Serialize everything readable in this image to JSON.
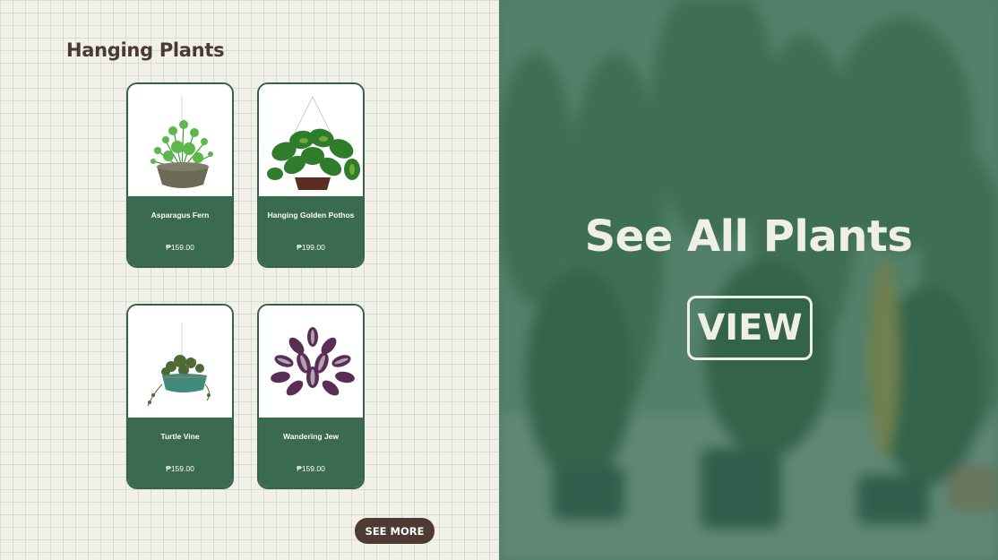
{
  "section": {
    "title": "Hanging Plants",
    "see_more_label": "SEE MORE"
  },
  "products": [
    {
      "name": "Asparagus Fern",
      "price": "₱159.00",
      "icon": "fern-plant-icon"
    },
    {
      "name": "Hanging Golden Pothos",
      "price": "₱199.00",
      "icon": "pothos-plant-icon"
    },
    {
      "name": "Turtle Vine",
      "price": "₱159.00",
      "icon": "turtle-vine-plant-icon"
    },
    {
      "name": "Wandering Jew",
      "price": "₱159.00",
      "icon": "wandering-jew-plant-icon"
    }
  ],
  "hero": {
    "title": "See All Plants",
    "button_label": "VIEW"
  },
  "colors": {
    "card_green": "#3a6a50",
    "brown_button": "#4e3a31",
    "title_brown": "#4a3a31",
    "background": "#f1f1ea"
  }
}
